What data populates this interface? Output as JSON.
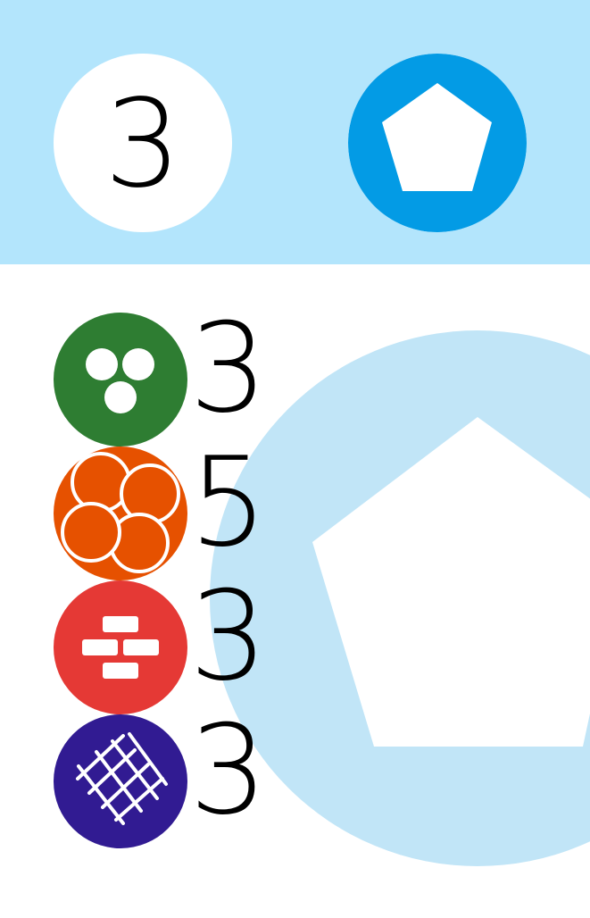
{
  "card": {
    "cost": "3",
    "type_icon": "pentagon-icon",
    "colors": {
      "header_bg": "#b3e5fc",
      "type_circle": "#039be5",
      "emblem": "#c1e5f7",
      "green": "#2e7d32",
      "orange": "#e65100",
      "red": "#e53935",
      "indigo": "#311b92"
    }
  },
  "requirements": [
    {
      "icon": "three-dots-icon",
      "color": "green",
      "count": "3"
    },
    {
      "icon": "four-petal-icon",
      "color": "orange",
      "count": "5"
    },
    {
      "icon": "bricks-icon",
      "color": "red",
      "count": "3"
    },
    {
      "icon": "crosshatch-icon",
      "color": "indigo",
      "count": "3"
    }
  ]
}
